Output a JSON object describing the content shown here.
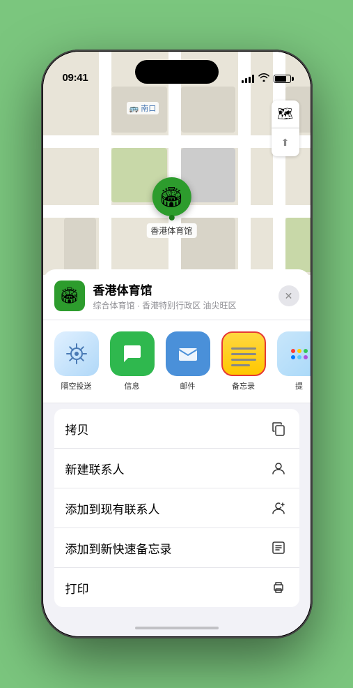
{
  "status": {
    "time": "09:41",
    "location_arrow": "▲"
  },
  "map": {
    "label_text": "南口",
    "label_prefix": "⬛"
  },
  "controls": {
    "map_btn": "🗺",
    "compass_btn": "⬆"
  },
  "pin": {
    "emoji": "🏟",
    "name": "香港体育馆"
  },
  "sheet": {
    "venue_emoji": "🏟",
    "venue_name": "香港体育馆",
    "venue_subtitle": "综合体育馆 · 香港特别行政区 油尖旺区",
    "close_label": "✕"
  },
  "share_items": [
    {
      "id": "airdrop",
      "label": "隔空投送"
    },
    {
      "id": "messages",
      "label": "信息"
    },
    {
      "id": "mail",
      "label": "邮件"
    },
    {
      "id": "notes",
      "label": "备忘录"
    },
    {
      "id": "more",
      "label": "提"
    }
  ],
  "actions": [
    {
      "label": "拷贝",
      "icon": "📋"
    },
    {
      "label": "新建联系人",
      "icon": "👤"
    },
    {
      "label": "添加到现有联系人",
      "icon": "👤"
    },
    {
      "label": "添加到新快速备忘录",
      "icon": "🖼"
    },
    {
      "label": "打印",
      "icon": "🖨"
    }
  ]
}
